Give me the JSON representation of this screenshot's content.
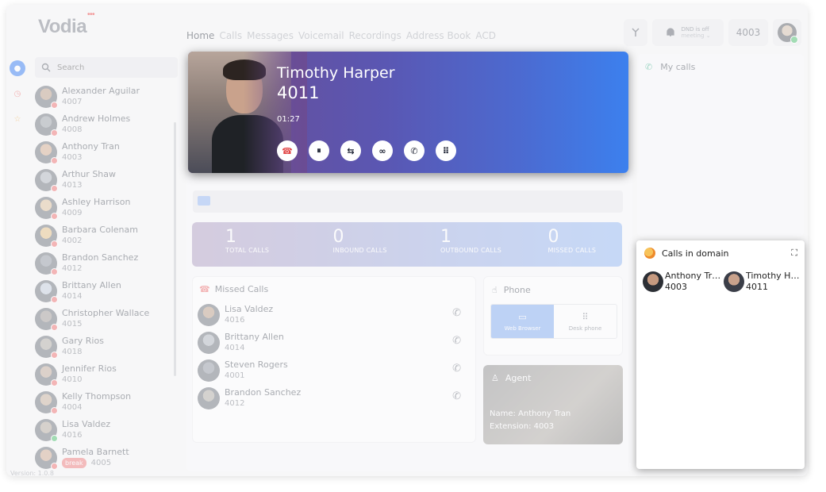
{
  "app": {
    "logo": "Vodia",
    "version": "Version: 1.0.8"
  },
  "nav": [
    "Home",
    "Calls",
    "Messages",
    "Voicemail",
    "Recordings",
    "Address Book",
    "ACD"
  ],
  "topbar": {
    "dnd_status": "DND is off",
    "dnd_mode": "meeting",
    "extension": "4003"
  },
  "search": {
    "placeholder": "Search"
  },
  "contacts": [
    {
      "name": "Alexander Aguilar",
      "ext": "4007",
      "status_color": "#f08080"
    },
    {
      "name": "Andrew Holmes",
      "ext": "4008",
      "status_color": "#f08080"
    },
    {
      "name": "Anthony Tran",
      "ext": "4003",
      "status_color": "#f08080"
    },
    {
      "name": "Arthur Shaw",
      "ext": "4013",
      "status_color": "#f08080"
    },
    {
      "name": "Ashley Harrison",
      "ext": "4009",
      "status_color": "#f08080"
    },
    {
      "name": "Barbara Colenam",
      "ext": "4002",
      "status_color": "#f08080"
    },
    {
      "name": "Brandon Sanchez",
      "ext": "4012",
      "status_color": "#f08080"
    },
    {
      "name": "Brittany Allen",
      "ext": "4014",
      "status_color": "#f08080"
    },
    {
      "name": "Christopher Wallace",
      "ext": "4015",
      "status_color": "#f08080"
    },
    {
      "name": "Gary Rios",
      "ext": "4018",
      "status_color": "#f08080"
    },
    {
      "name": "Jennifer Rios",
      "ext": "4010",
      "status_color": "#f08080"
    },
    {
      "name": "Kelly Thompson",
      "ext": "4004",
      "status_color": "#f08080"
    },
    {
      "name": "Lisa Valdez",
      "ext": "4016",
      "status_color": "#5dc67d"
    },
    {
      "name": "Pamela Barnett",
      "ext": "4005",
      "status_color": "#f08080",
      "badge": "break"
    }
  ],
  "active_call": {
    "name": "Timothy Harper",
    "ext": "4011",
    "duration": "01:27"
  },
  "stats": [
    {
      "value": "1",
      "label": "TOTAL CALLS"
    },
    {
      "value": "0",
      "label": "INBOUND CALLS"
    },
    {
      "value": "1",
      "label": "OUTBOUND CALLS"
    },
    {
      "value": "0",
      "label": "MISSED CALLS"
    }
  ],
  "missed_calls": {
    "title": "Missed Calls",
    "items": [
      {
        "name": "Lisa Valdez",
        "ext": "4016"
      },
      {
        "name": "Brittany Allen",
        "ext": "4014"
      },
      {
        "name": "Steven Rogers",
        "ext": "4001"
      },
      {
        "name": "Brandon Sanchez",
        "ext": "4012"
      }
    ]
  },
  "phone": {
    "title": "Phone",
    "tab_web": "Web Browser",
    "tab_desk": "Desk phone"
  },
  "agent": {
    "title": "Agent",
    "name_line": "Name: Anthony Tran",
    "ext_line": "Extension: 4003"
  },
  "my_calls": {
    "title": "My calls"
  },
  "domain_calls": {
    "title": "Calls in domain",
    "items": [
      {
        "name": "Anthony Tran",
        "ext": "4003"
      },
      {
        "name": "Timothy Har...",
        "ext": "4011"
      }
    ]
  }
}
